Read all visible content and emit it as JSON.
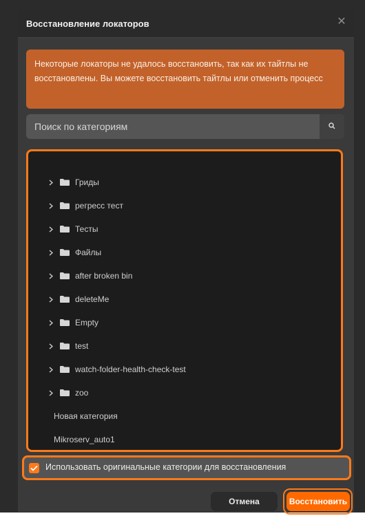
{
  "dialog": {
    "title": "Восстановление локаторов",
    "close_icon": "close-icon",
    "warning": "Некоторые локаторы не удалось восстановить, так как их тайтлы не восстановлены. Вы можете восстановить тайтлы или отменить процесс",
    "search": {
      "placeholder": "Поиск по категориям",
      "icon": "search-icon"
    },
    "tree": {
      "folders": [
        {
          "label": "Гриды"
        },
        {
          "label": "регресс тест"
        },
        {
          "label": "Тесты"
        },
        {
          "label": "Файлы"
        },
        {
          "label": "after broken bin"
        },
        {
          "label": "deleteMe"
        },
        {
          "label": "Empty"
        },
        {
          "label": "test"
        },
        {
          "label": "watch-folder-health-check-test"
        },
        {
          "label": "zoo"
        }
      ],
      "leaves": [
        {
          "label": "Новая категория"
        },
        {
          "label": "Mikroserv_auto1"
        }
      ]
    },
    "option": {
      "label": "Использовать оригинальные категории для восстановления",
      "checked": true
    },
    "buttons": {
      "cancel": "Отмена",
      "restore": "Восстановить"
    },
    "colors": {
      "accent": "#ff7a1a",
      "warning_bg": "#c2622a",
      "dialog_bg": "#3a3a3a",
      "tree_bg": "#1c1c1c"
    }
  }
}
